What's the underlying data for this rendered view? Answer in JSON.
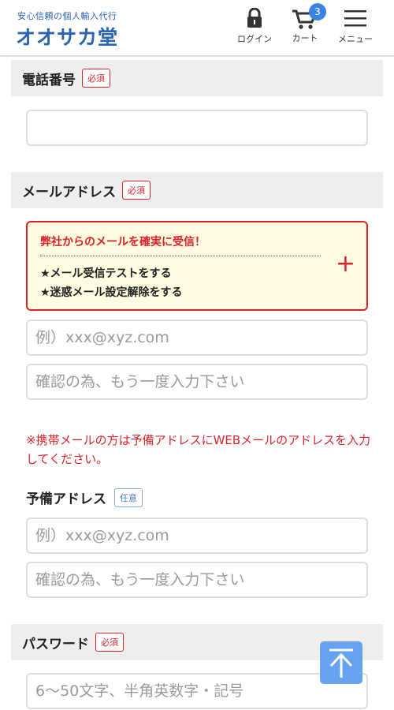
{
  "header": {
    "tagline": "安心信頼の個人輸入代行",
    "logo": "オオサカ堂",
    "nav": {
      "login_label": "ログイン",
      "cart_label": "カート",
      "cart_count": "3",
      "menu_label": "メニュー"
    }
  },
  "phone_section": {
    "title": "電話番号",
    "required_badge": "必須"
  },
  "email_section": {
    "title": "メールアドレス",
    "required_badge": "必須",
    "notice": {
      "title": "弊社からのメールを確実に受信！",
      "line1": "★メール受信テストをする",
      "line2": "★迷惑メール設定解除をする",
      "expand_symbol": "+"
    },
    "email_placeholder": "例）xxx@xyz.com",
    "confirm_placeholder": "確認の為、もう一度入力下さい",
    "mobile_warning": "※携帯メールの方は予備アドレスにWEBメールのアドレスを入力してください。"
  },
  "backup_section": {
    "title": "予備アドレス",
    "optional_badge": "任意",
    "email_placeholder": "例）xxx@xyz.com",
    "confirm_placeholder": "確認の為、もう一度入力下さい"
  },
  "password_section": {
    "title": "パスワード",
    "required_badge": "必須",
    "placeholder": "6〜50文字、半角英数字・記号"
  },
  "colors": {
    "brand_blue": "#2b63b5",
    "required_red": "#d8232a",
    "notice_bg": "#fffbe0",
    "scroll_button": "#5b9cf0"
  },
  "icons": {
    "login": "lock-icon",
    "cart": "cart-icon",
    "menu": "hamburger-icon",
    "scroll_top": "arrow-up-icon"
  }
}
